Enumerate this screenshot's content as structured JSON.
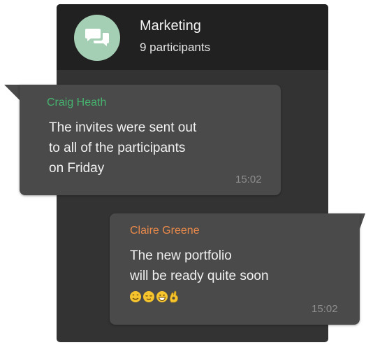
{
  "chat": {
    "title": "Marketing",
    "participants": "9 participants",
    "avatar_icon": "chat-bubbles-icon",
    "avatar_color": "#a5cfb4"
  },
  "messages": [
    {
      "sender": "Craig Heath",
      "sender_color": "#46b36f",
      "lines": [
        "The invites were sent out",
        "to all of the participants",
        "on Friday"
      ],
      "time": "15:02"
    },
    {
      "sender": "Claire Greene",
      "sender_color": "#e8894a",
      "lines": [
        "The new portfolio",
        "will be ready quite soon"
      ],
      "emojis": [
        "smiling-face-icon",
        "relieved-face-icon",
        "grinning-face-icon",
        "ok-hand-icon"
      ],
      "time": "15:02"
    }
  ]
}
